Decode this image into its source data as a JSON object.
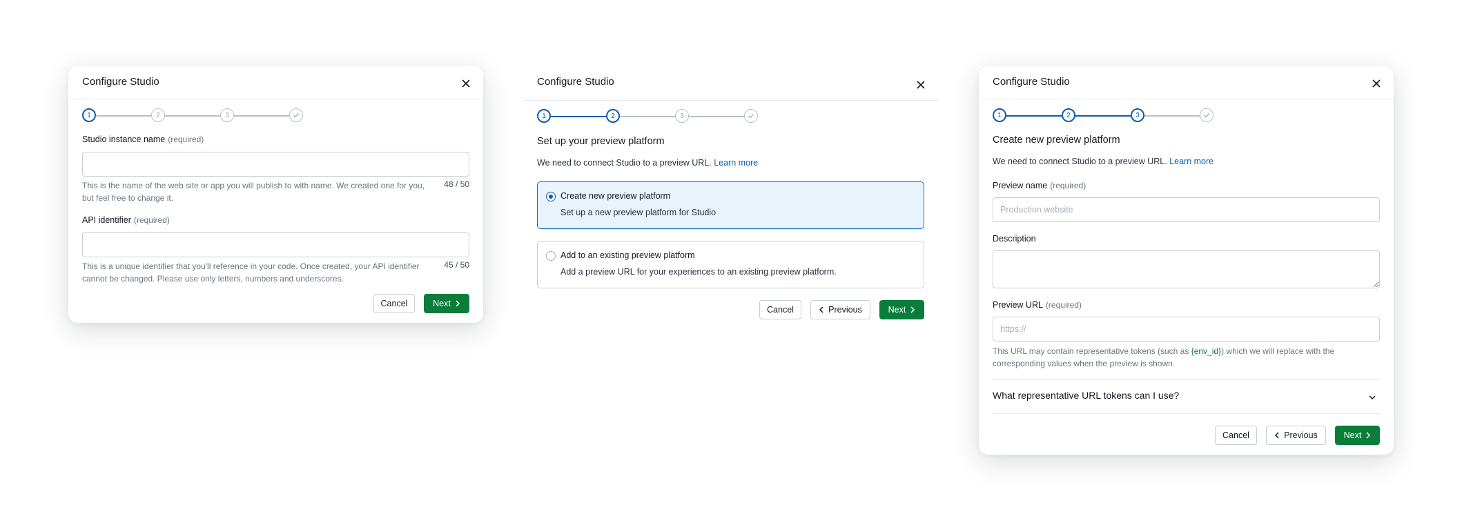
{
  "common": {
    "dialog_title": "Configure Studio",
    "cancel_label": "Cancel",
    "next_label": "Next",
    "previous_label": "Previous",
    "required_hint": "(required)",
    "steps": [
      "1",
      "2",
      "3"
    ]
  },
  "dialog1": {
    "field1": {
      "label": "Studio instance name",
      "help": "This is the name of the web site or app you will publish to with name. We created one for you, but feel free to change it.",
      "counter": "48 / 50",
      "value": ""
    },
    "field2": {
      "label": "API identifier",
      "help": "This is a unique identifier that you'll reference in your code. Once created, your API identifier cannot be changed. Please use only letters, numbers and underscores.",
      "counter": "45 / 50",
      "value": ""
    }
  },
  "dialog2": {
    "heading": "Set up your preview platform",
    "intro": "We need to connect Studio to a preview URL.",
    "learn_more": "Learn more",
    "options": [
      {
        "title": "Create new preview platform",
        "desc": "Set up a new preview platform for Studio",
        "selected": true
      },
      {
        "title": "Add to an existing preview platform",
        "desc": "Add a preview URL for your experiences to an existing preview platform.",
        "selected": false
      }
    ]
  },
  "dialog3": {
    "heading": "Create new preview platform",
    "intro": "We need to connect Studio to a preview URL.",
    "learn_more": "Learn more",
    "preview_name": {
      "label": "Preview name",
      "placeholder": "Production website"
    },
    "description": {
      "label": "Description"
    },
    "preview_url": {
      "label": "Preview URL",
      "placeholder": "https://",
      "help_before": "This URL may contain representative tokens (such as ",
      "token": "{env_id}",
      "help_after": ") which we will replace with the corresponding values when the preview is shown."
    },
    "accordion_title": "What representative URL tokens can I use?"
  },
  "colors": {
    "primary_button": "#0a7d3b",
    "active_step": "#0b5cad",
    "link": "#0b5cad",
    "selected_option_bg": "#e8f3fb"
  },
  "icons": [
    "close-icon",
    "check-icon",
    "chevron-right-icon",
    "chevron-left-icon",
    "chevron-down-icon"
  ]
}
